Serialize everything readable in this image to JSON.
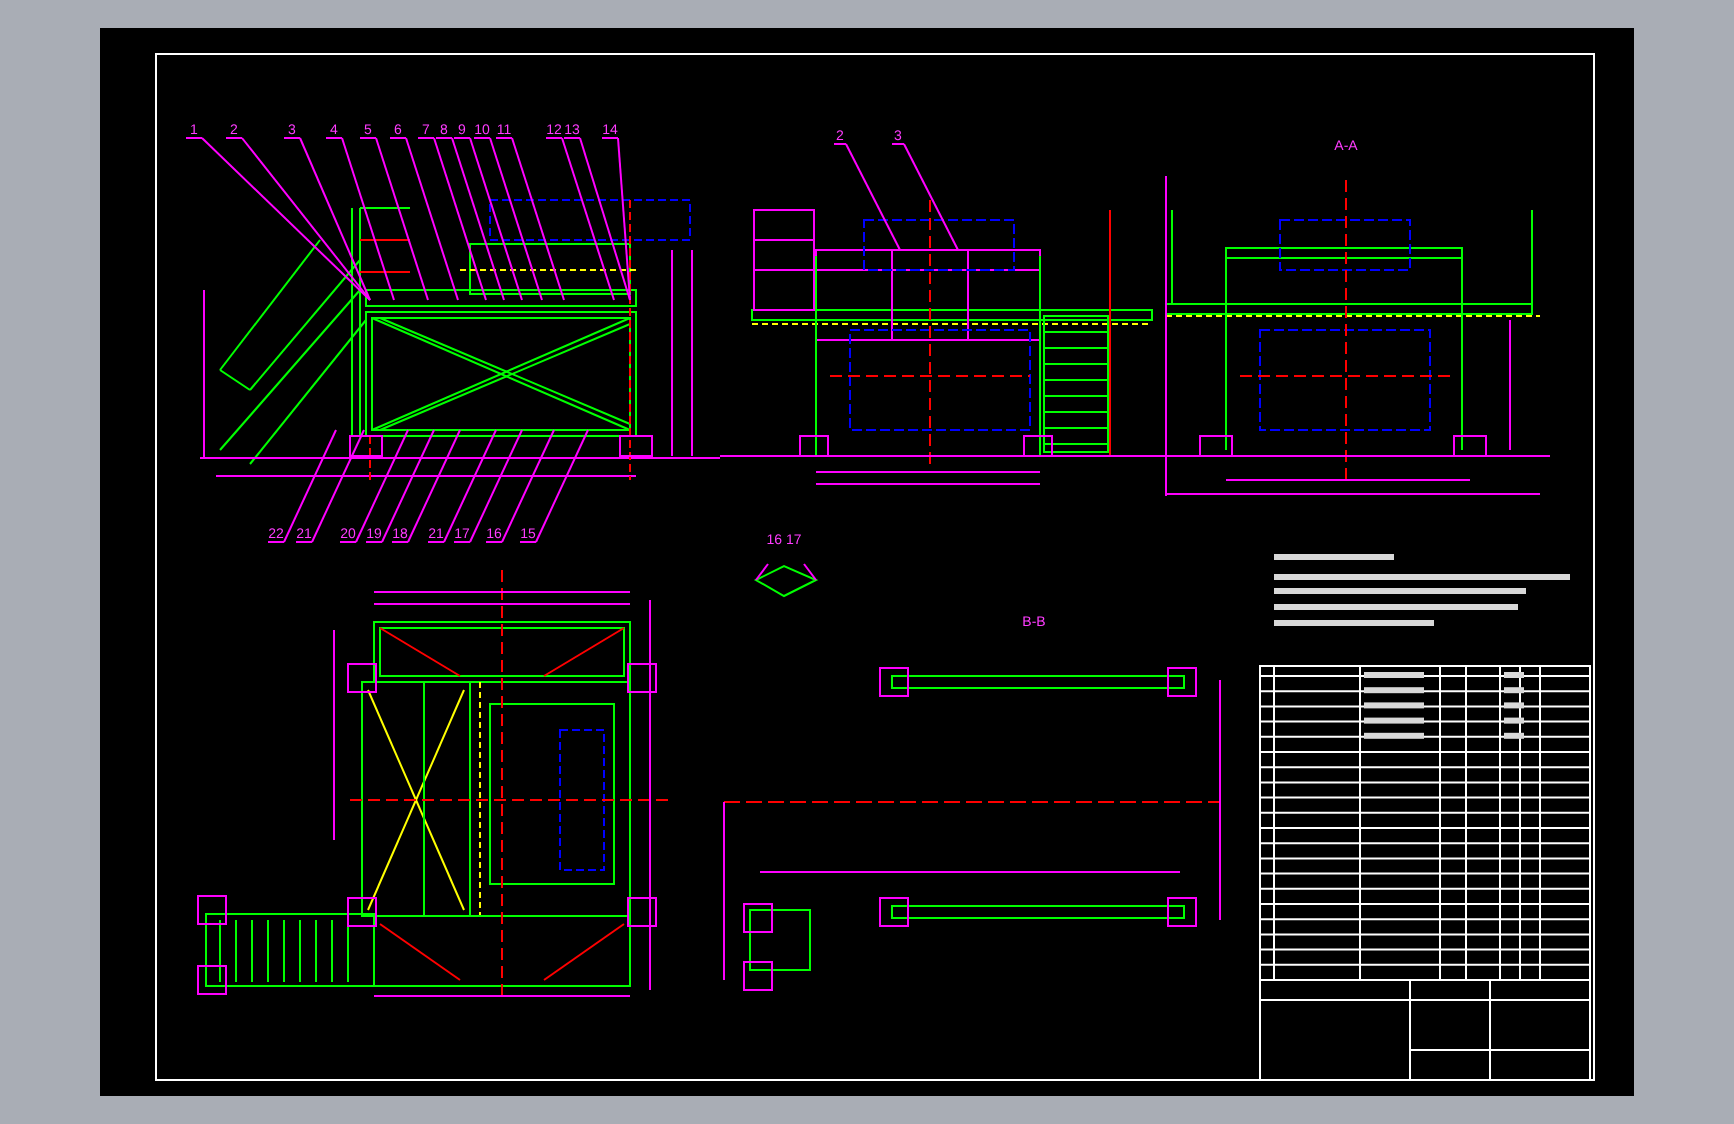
{
  "drawing": {
    "top_balloons": [
      "1",
      "2",
      "3",
      "4",
      "5",
      "6",
      "7",
      "8",
      "9",
      "10",
      "11",
      "12",
      "13",
      "14"
    ],
    "bottom_balloons": [
      "22",
      "21",
      "20",
      "19",
      "18",
      "21",
      "17",
      "16",
      "15"
    ],
    "front_view_balloons": [
      "2",
      "3"
    ],
    "section_labels": [
      "A-A",
      "B-B"
    ],
    "detail_label": "16  17"
  }
}
